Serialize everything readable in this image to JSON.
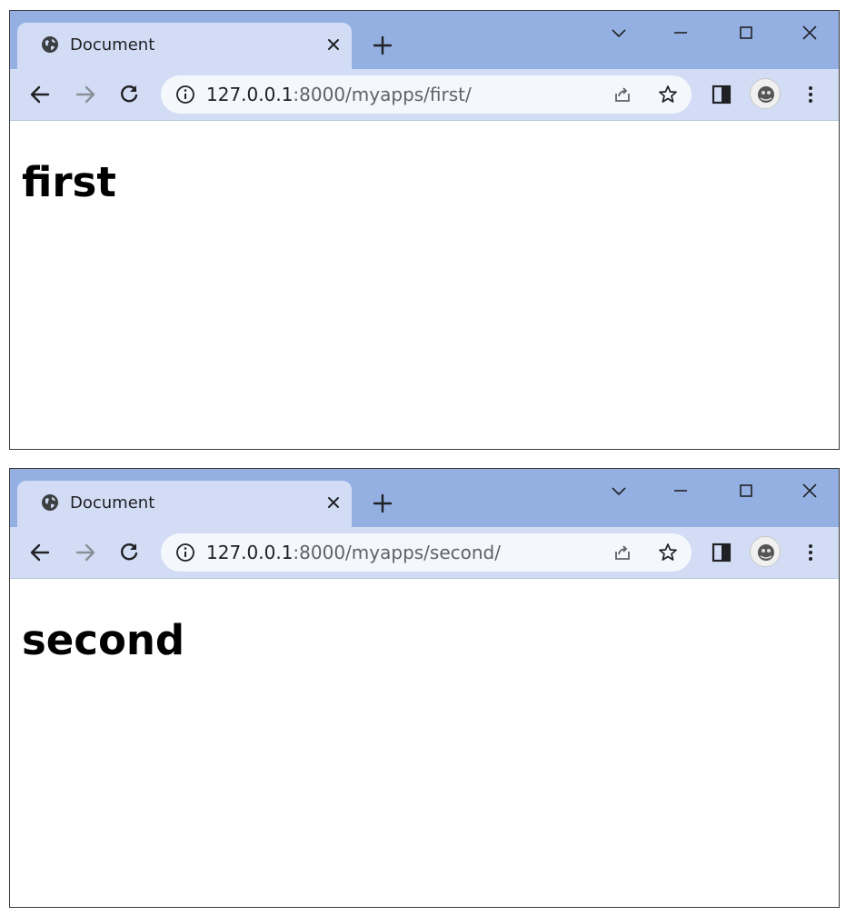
{
  "windows": [
    {
      "tab": {
        "title": "Document"
      },
      "address": {
        "host": "127.0.0.1",
        "rest": ":8000/myapps/first/"
      },
      "page": {
        "heading": "first"
      }
    },
    {
      "tab": {
        "title": "Document"
      },
      "address": {
        "host": "127.0.0.1",
        "rest": ":8000/myapps/second/"
      },
      "page": {
        "heading": "second"
      }
    }
  ],
  "colors": {
    "titlebar": "#94b0e3",
    "tab_and_toolbar": "#d2ddf5",
    "omnibox": "#f4f7fc"
  },
  "icons": [
    "globe-icon",
    "close-icon",
    "plus-icon",
    "chevron-down-icon",
    "minimize-icon",
    "maximize-icon",
    "window-close-icon",
    "back-arrow-icon",
    "forward-arrow-icon",
    "reload-icon",
    "info-icon",
    "share-icon",
    "star-icon",
    "side-panel-icon",
    "profile-avatar",
    "kebab-menu-icon"
  ]
}
